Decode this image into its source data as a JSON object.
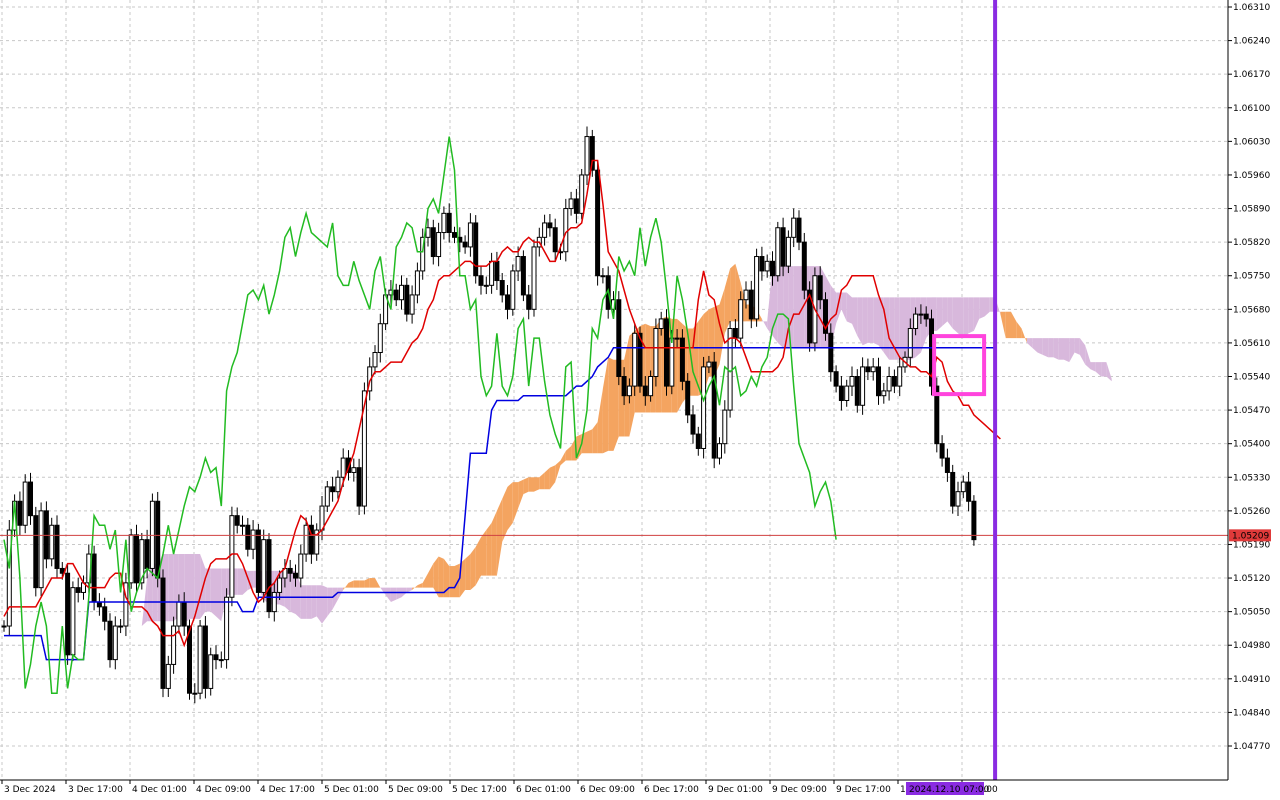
{
  "chart_data": {
    "type": "candlestick",
    "ylim": [
      1.04735,
      1.06335
    ],
    "grid": true,
    "y_ticks": [
      "1.06310",
      "1.06240",
      "1.06170",
      "1.06100",
      "1.06030",
      "1.05960",
      "1.05890",
      "1.05820",
      "1.05750",
      "1.05680",
      "1.05610",
      "1.05540",
      "1.05470",
      "1.05400",
      "1.05330",
      "1.05260",
      "1.05190",
      "1.05120",
      "1.05050",
      "1.04980",
      "1.04910",
      "1.04840",
      "1.04770"
    ],
    "x_ticks": [
      "3 Dec 2024",
      "3 Dec 17:00",
      "4 Dec 01:00",
      "4 Dec 09:00",
      "4 Dec 17:00",
      "5 Dec 01:00",
      "5 Dec 09:00",
      "5 Dec 17:00",
      "6 Dec 01:00",
      "6 Dec 09:00",
      "6 Dec 17:00",
      "9 Dec 01:00",
      "9 Dec 09:00",
      "9 Dec 17:00",
      "10",
      "c 09:00"
    ],
    "current_price": "1.05209",
    "current_price_value": 1.05209,
    "vline_label": "2024.12.10 07:00",
    "vline_bar": 187,
    "colors": {
      "tenkan": "#e00000",
      "kijun": "#0000e0",
      "chikou": "#22bb22",
      "cloud_bull": "#f4a460",
      "cloud_bear": "#d8b8dc",
      "vline": "#8a2be2",
      "marker": "#ff44dd",
      "price_line": "#d04040"
    },
    "series": [
      {
        "name": "close",
        "values": [
          1.0502,
          1.0522,
          1.0528,
          1.0523,
          1.0532,
          1.0525,
          1.051,
          1.0526,
          1.0516,
          1.0523,
          1.0514,
          1.0513,
          1.0496,
          1.051,
          1.0509,
          1.0511,
          1.0517,
          1.0507,
          1.0506,
          1.0503,
          1.0495,
          1.0502,
          1.0502,
          1.0511,
          1.0521,
          1.0511,
          1.052,
          1.0514,
          1.0528,
          1.0512,
          1.0489,
          1.0494,
          1.0502,
          1.0507,
          1.0502,
          1.0488,
          1.0488,
          1.0502,
          1.0489,
          1.0496,
          1.0495,
          1.0495,
          1.0508,
          1.0525,
          1.0523,
          1.0523,
          1.0518,
          1.0522,
          1.0509,
          1.052,
          1.0505,
          1.0509,
          1.0512,
          1.0514,
          1.0513,
          1.0512,
          1.0517,
          1.0523,
          1.0517,
          1.0522,
          1.0527,
          1.0531,
          1.053,
          1.0533,
          1.0537,
          1.0534,
          1.0535,
          1.0527,
          1.0551,
          1.0556,
          1.0559,
          1.0565,
          1.0571,
          1.0572,
          1.057,
          1.0573,
          1.0567,
          1.0571,
          1.0576,
          1.0583,
          1.0585,
          1.0579,
          1.0584,
          1.0588,
          1.0584,
          1.0583,
          1.0582,
          1.0581,
          1.0586,
          1.0575,
          1.0573,
          1.0573,
          1.0578,
          1.0574,
          1.0571,
          1.0568,
          1.0576,
          1.0579,
          1.0571,
          1.0568,
          1.0581,
          1.0583,
          1.0586,
          1.0585,
          1.058,
          1.058,
          1.0589,
          1.0591,
          1.0588,
          1.0596,
          1.0604,
          1.0597,
          1.0575,
          1.0575,
          1.0568,
          1.057,
          1.0554,
          1.055,
          1.0552,
          1.0563,
          1.0552,
          1.055,
          1.0554,
          1.0564,
          1.0566,
          1.0552,
          1.0562,
          1.0562,
          1.0553,
          1.0546,
          1.0542,
          1.0539,
          1.0556,
          1.0557,
          1.0537,
          1.054,
          1.0547,
          1.0564,
          1.0562,
          1.057,
          1.0572,
          1.0566,
          1.0579,
          1.0576,
          1.0578,
          1.0575,
          1.0585,
          1.0577,
          1.0583,
          1.0587,
          1.0582,
          1.0572,
          1.0561,
          1.0575,
          1.057,
          1.0563,
          1.0555,
          1.0552,
          1.0549,
          1.0552,
          1.0554,
          1.0548,
          1.0556,
          1.0555,
          1.0556,
          1.055,
          1.0551,
          1.0554,
          1.0552,
          1.0556,
          1.0558,
          1.0564,
          1.0567,
          1.0567,
          1.0566,
          1.0552,
          1.054,
          1.0537,
          1.0534,
          1.0527,
          1.053,
          1.0532,
          1.0528,
          1.052
        ]
      },
      {
        "name": "tenkan",
        "values": [
          1.0504,
          1.0506,
          1.0506,
          1.0506,
          1.0506,
          1.0506,
          1.0506,
          1.0508,
          1.051,
          1.0512,
          1.0512,
          1.0512,
          1.0515,
          1.0515,
          1.0513,
          1.0511,
          1.051,
          1.051,
          1.051,
          1.051,
          1.0512,
          1.0513,
          1.0513,
          1.0508,
          1.0506,
          1.0506,
          1.0506,
          1.0505,
          1.0503,
          1.0502,
          1.05,
          1.05,
          1.05,
          1.0501,
          1.0498,
          1.0501,
          1.0504,
          1.0508,
          1.0512,
          1.0515,
          1.0516,
          1.0516,
          1.0516,
          1.0517,
          1.0517,
          1.0515,
          1.0512,
          1.0509,
          1.0507,
          1.0508,
          1.051,
          1.0511,
          1.0513,
          1.0514,
          1.0518,
          1.0522,
          1.0525,
          1.0524,
          1.0521,
          1.0521,
          1.0522,
          1.0524,
          1.0526,
          1.0528,
          1.0532,
          1.0535,
          1.0538,
          1.0543,
          1.0548,
          1.0553,
          1.0555,
          1.0555,
          1.0556,
          1.0557,
          1.0557,
          1.0557,
          1.0559,
          1.0561,
          1.0562,
          1.0564,
          1.0568,
          1.057,
          1.0574,
          1.0575,
          1.0575,
          1.0576,
          1.0577,
          1.0578,
          1.0578,
          1.0577,
          1.0577,
          1.0577,
          1.0578,
          1.0578,
          1.058,
          1.0581,
          1.058,
          1.058,
          1.0582,
          1.0583,
          1.0582,
          1.0582,
          1.058,
          1.0578,
          1.0578,
          1.0581,
          1.0584,
          1.0585,
          1.0585,
          1.0586,
          1.0592,
          1.0599,
          1.0599,
          1.059,
          1.058,
          1.0578,
          1.0576,
          1.0572,
          1.0568,
          1.0565,
          1.0562,
          1.056,
          1.056,
          1.056,
          1.056,
          1.056,
          1.056,
          1.056,
          1.056,
          1.056,
          1.056,
          1.057,
          1.0576,
          1.0571,
          1.057,
          1.0565,
          1.0561,
          1.0562,
          1.0562,
          1.0561,
          1.0558,
          1.0555,
          1.0555,
          1.0555,
          1.0555,
          1.0555,
          1.0556,
          1.0558,
          1.0564,
          1.0567,
          1.0567,
          1.0569,
          1.0571,
          1.0568,
          1.0566,
          1.0564,
          1.0566,
          1.0567,
          1.0572,
          1.0573,
          1.0575,
          1.0575,
          1.0575,
          1.0575,
          1.0575,
          1.0571,
          1.0568,
          1.0562,
          1.056,
          1.0558,
          1.0557,
          1.0556,
          1.0556,
          1.0555,
          1.0555,
          1.0554,
          1.0558,
          1.0557,
          1.0553,
          1.0551,
          1.055,
          1.0548,
          1.0548,
          1.0546,
          1.0545,
          1.0544,
          1.0543,
          1.0542,
          1.0541
        ]
      },
      {
        "name": "kijun",
        "values": [
          1.05,
          1.05,
          1.05,
          1.05,
          1.05,
          1.05,
          1.05,
          1.05,
          1.0495,
          1.0495,
          1.0495,
          1.0495,
          1.0495,
          1.0495,
          1.0495,
          1.0495,
          1.0507,
          1.0507,
          1.0507,
          1.0507,
          1.0507,
          1.0507,
          1.0507,
          1.0507,
          1.0507,
          1.0507,
          1.0507,
          1.0507,
          1.0507,
          1.0507,
          1.0507,
          1.0507,
          1.0507,
          1.0507,
          1.0507,
          1.0507,
          1.0507,
          1.0507,
          1.0507,
          1.0507,
          1.0507,
          1.0507,
          1.0507,
          1.0507,
          1.0507,
          1.0505,
          1.0505,
          1.0505,
          1.0508,
          1.0508,
          1.0508,
          1.0508,
          1.0508,
          1.0508,
          1.0508,
          1.0508,
          1.0508,
          1.0508,
          1.0508,
          1.0508,
          1.0508,
          1.0508,
          1.0508,
          1.0509,
          1.0509,
          1.0509,
          1.0509,
          1.0509,
          1.0509,
          1.0509,
          1.0509,
          1.0509,
          1.0509,
          1.0509,
          1.0509,
          1.0509,
          1.0509,
          1.0509,
          1.0509,
          1.0509,
          1.0509,
          1.0509,
          1.0509,
          1.0509,
          1.051,
          1.051,
          1.0512,
          1.0525,
          1.0538,
          1.0538,
          1.0538,
          1.0538,
          1.0547,
          1.0549,
          1.0549,
          1.0549,
          1.0549,
          1.0549,
          1.055,
          1.055,
          1.055,
          1.055,
          1.055,
          1.055,
          1.055,
          1.055,
          1.055,
          1.0551,
          1.0552,
          1.0552,
          1.0553,
          1.0554,
          1.0556,
          1.0557,
          1.0558,
          1.056,
          1.056,
          1.056,
          1.056,
          1.056,
          1.056,
          1.056,
          1.056,
          1.056,
          1.056,
          1.056,
          1.056,
          1.056,
          1.056,
          1.056,
          1.056,
          1.056,
          1.056,
          1.056,
          1.056,
          1.056,
          1.056,
          1.056,
          1.056,
          1.056,
          1.056,
          1.056,
          1.056,
          1.056,
          1.056,
          1.056,
          1.056,
          1.056,
          1.056,
          1.056,
          1.056,
          1.056,
          1.056,
          1.056,
          1.056,
          1.056,
          1.056,
          1.056,
          1.056,
          1.056,
          1.056,
          1.056,
          1.056,
          1.056,
          1.056,
          1.056,
          1.056,
          1.056,
          1.056,
          1.056,
          1.056,
          1.056,
          1.056,
          1.056,
          1.056,
          1.056,
          1.056,
          1.056,
          1.056,
          1.056,
          1.056,
          1.056,
          1.056,
          1.056,
          1.056,
          1.056,
          1.056,
          1.056
        ]
      }
    ]
  }
}
